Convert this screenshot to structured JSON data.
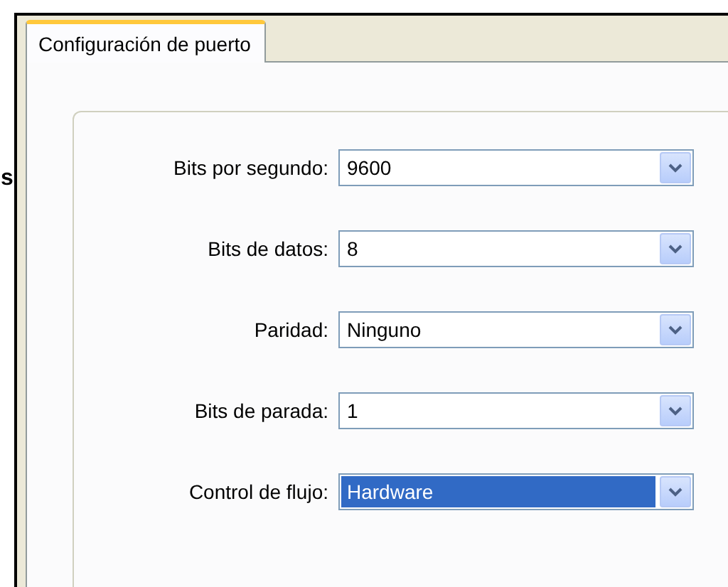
{
  "edge_text": "s",
  "tabs": [
    {
      "label": "Configuración de puerto",
      "selected": true
    }
  ],
  "fields": [
    {
      "label": "Bits por segundo:",
      "value": "9600",
      "highlighted": false
    },
    {
      "label": "Bits de datos:",
      "value": "8",
      "highlighted": false
    },
    {
      "label": "Paridad:",
      "value": "Ninguno",
      "highlighted": false
    },
    {
      "label": "Bits de parada:",
      "value": "1",
      "highlighted": false
    },
    {
      "label": "Control de flujo:",
      "value": "Hardware",
      "highlighted": true
    }
  ]
}
